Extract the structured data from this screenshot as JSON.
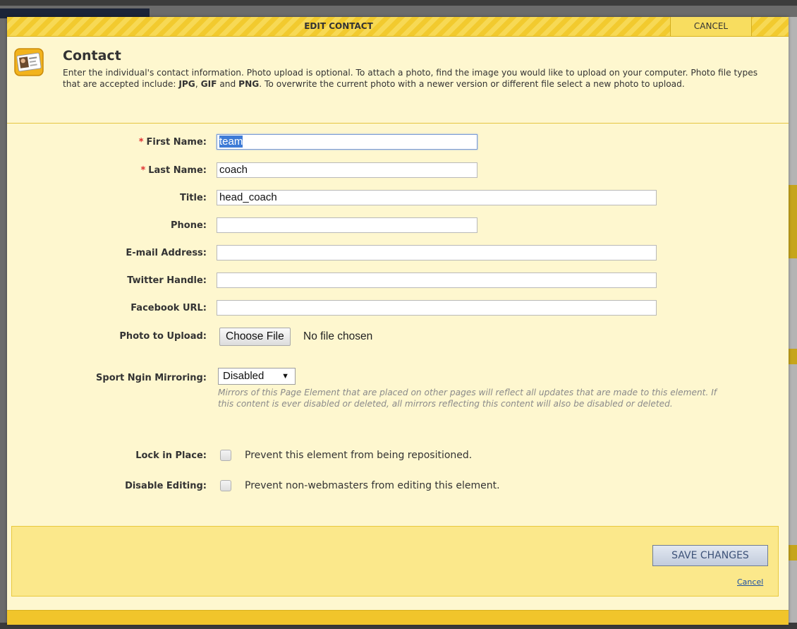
{
  "modal": {
    "title": "EDIT CONTACT",
    "cancel_label": "CANCEL"
  },
  "intro": {
    "heading": "Contact",
    "text_1": "Enter the individual's contact information. Photo upload is optional. To attach a photo, find the image you would like to upload on your computer. Photo file types that are accepted include: ",
    "fmt_jpg": "JPG",
    "sep_1": ", ",
    "fmt_gif": "GIF",
    "sep_2": " and ",
    "fmt_png": "PNG",
    "text_2": ". To overwrite the current photo with a newer version or different file select a new photo to upload.",
    "icon": "contact-card-icon"
  },
  "form": {
    "required_mark": "*",
    "first_name": {
      "label": "First Name:",
      "value": "team"
    },
    "last_name": {
      "label": "Last Name:",
      "value": "coach"
    },
    "title": {
      "label": "Title:",
      "value": "head_coach"
    },
    "phone": {
      "label": "Phone:",
      "value": ""
    },
    "email": {
      "label": "E-mail Address:",
      "value": ""
    },
    "twitter": {
      "label": "Twitter Handle:",
      "value": ""
    },
    "facebook": {
      "label": "Facebook URL:",
      "value": ""
    },
    "photo": {
      "label": "Photo to Upload:",
      "button": "Choose File",
      "status": "No file chosen"
    },
    "mirroring": {
      "label": "Sport Ngin Mirroring:",
      "selected": "Disabled",
      "arrow": "▼",
      "help": "Mirrors of this Page Element that are placed on other pages will reflect all updates that are made to this element. If this content is ever disabled or deleted, all mirrors reflecting this content will also be disabled or deleted."
    },
    "lock": {
      "label": "Lock in Place:",
      "checked": false,
      "text": "Prevent this element from being repositioned."
    },
    "disable_editing": {
      "label": "Disable Editing:",
      "checked": false,
      "text": "Prevent non-webmasters from editing this element."
    }
  },
  "footer": {
    "save_label": "SAVE CHANGES",
    "cancel_link": "Cancel"
  },
  "colors": {
    "modal_bg": "#fef7cf",
    "header_stripe": "#f2ca2e",
    "footer_bg": "#fbe88b",
    "required": "#e03030",
    "link": "#1b4fa3"
  }
}
